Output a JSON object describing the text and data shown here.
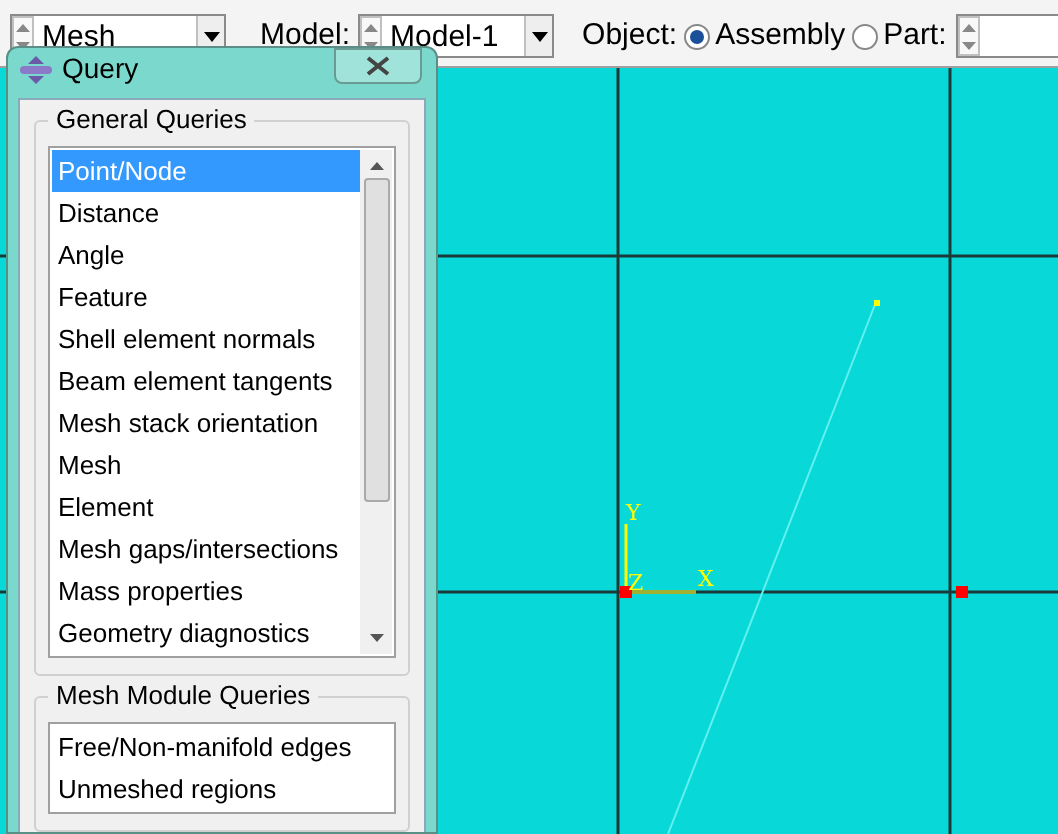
{
  "toolbar": {
    "module": "Mesh",
    "model_label": "Model:",
    "model": "Model-1",
    "object_label": "Object:",
    "object_options": [
      {
        "label": "Assembly",
        "selected": true
      },
      {
        "label": "Part:",
        "selected": false
      }
    ]
  },
  "query_dialog": {
    "title": "Query",
    "groups": [
      {
        "title": "General Queries",
        "items": [
          {
            "label": "Point/Node",
            "selected": true
          },
          {
            "label": "Distance",
            "selected": false
          },
          {
            "label": "Angle",
            "selected": false
          },
          {
            "label": "Feature",
            "selected": false
          },
          {
            "label": "Shell element normals",
            "selected": false
          },
          {
            "label": "Beam element tangents",
            "selected": false
          },
          {
            "label": "Mesh stack orientation",
            "selected": false
          },
          {
            "label": "Mesh",
            "selected": false
          },
          {
            "label": "Element",
            "selected": false
          },
          {
            "label": "Mesh gaps/intersections",
            "selected": false
          },
          {
            "label": "Mass properties",
            "selected": false
          },
          {
            "label": "Geometry diagnostics",
            "selected": false
          }
        ]
      },
      {
        "title": "Mesh Module Queries",
        "items": [
          {
            "label": "Free/Non-manifold edges",
            "selected": false
          },
          {
            "label": "Unmeshed regions",
            "selected": false
          }
        ]
      }
    ]
  },
  "viewport": {
    "triad": {
      "y_label": "Y",
      "z_label": "Z",
      "x_label": "X"
    }
  }
}
